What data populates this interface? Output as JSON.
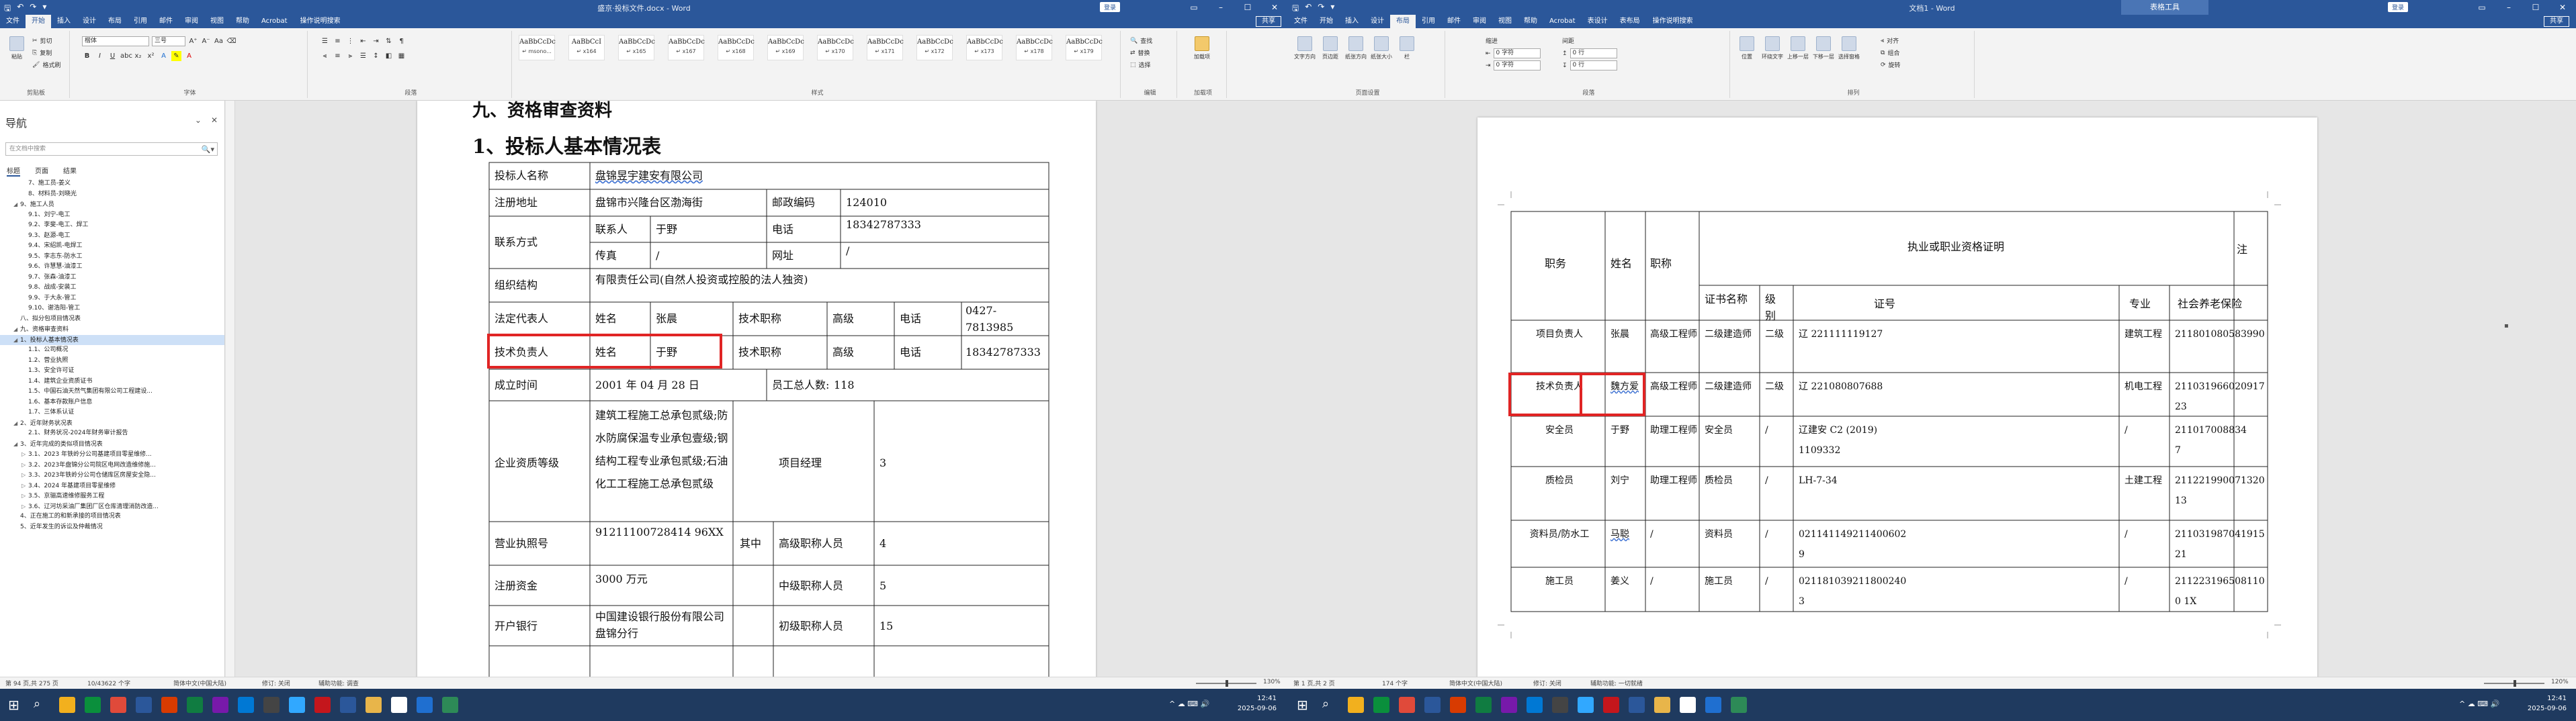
{
  "left": {
    "title": "盛京·投标文件.docx - Word",
    "user_button": "登录",
    "share": "共享",
    "tabs": [
      "文件",
      "开始",
      "插入",
      "设计",
      "布局",
      "引用",
      "邮件",
      "审阅",
      "视图",
      "帮助",
      "Acrobat"
    ],
    "tell_me": "操作说明搜索",
    "ribbon": {
      "clipboard": {
        "label": "剪贴板",
        "paste": "粘贴",
        "cut": "剪切",
        "copy": "复制",
        "painter": "格式刷"
      },
      "font": {
        "label": "字体",
        "name": "楷体",
        "size": "三号"
      },
      "paragraph": {
        "label": "段落"
      },
      "styles": {
        "label": "样式",
        "items": [
          {
            "sample": "AaBbCcDc",
            "name": "↵ msono..."
          },
          {
            "sample": "AaBbCcI",
            "name": "↵ x164"
          },
          {
            "sample": "AaBbCcDc",
            "name": "↵ x165"
          },
          {
            "sample": "AaBbCcDc",
            "name": "↵ x167"
          },
          {
            "sample": "AaBbCcDc",
            "name": "↵ x168"
          },
          {
            "sample": "AaBbCcDc",
            "name": "↵ x169"
          },
          {
            "sample": "AaBbCcDc",
            "name": "↵ x170"
          },
          {
            "sample": "AaBbCcDc",
            "name": "↵ x171"
          },
          {
            "sample": "AaBbCcDc",
            "name": "↵ x172"
          },
          {
            "sample": "AaBbCcDc",
            "name": "↵ x173"
          },
          {
            "sample": "AaBbCcDc",
            "name": "↵ x178"
          },
          {
            "sample": "AaBbCcDc",
            "name": "↵ x179"
          }
        ]
      },
      "editing": {
        "label": "编辑",
        "find": "查找",
        "replace": "替换",
        "select": "选择"
      },
      "addin": {
        "label": "加载项",
        "btn": "加载项"
      }
    },
    "nav": {
      "title": "导航",
      "search_placeholder": "在文档中搜索",
      "tabs": [
        "标题",
        "页面",
        "结果"
      ],
      "items": [
        {
          "level": 2,
          "caret": "",
          "text": "7、施工员-姜义"
        },
        {
          "level": 2,
          "caret": "",
          "text": "8、材料员-刘晓光"
        },
        {
          "level": 1,
          "caret": "◢",
          "text": "9、施工人员"
        },
        {
          "level": 2,
          "caret": "",
          "text": "9.1、刘宁-电工"
        },
        {
          "level": 2,
          "caret": "",
          "text": "9.2、李斐-电工、焊工"
        },
        {
          "level": 2,
          "caret": "",
          "text": "9.3、赵源-电工"
        },
        {
          "level": 2,
          "caret": "",
          "text": "9.4、宋绍凯-电焊工"
        },
        {
          "level": 2,
          "caret": "",
          "text": "9.5、李志东-防水工"
        },
        {
          "level": 2,
          "caret": "",
          "text": "9.6、许慧慧-油漆工"
        },
        {
          "level": 2,
          "caret": "",
          "text": "9.7、张森-油漆工"
        },
        {
          "level": 2,
          "caret": "",
          "text": "9.8、战成-安装工"
        },
        {
          "level": 2,
          "caret": "",
          "text": "9.9、于大永-管工"
        },
        {
          "level": 2,
          "caret": "",
          "text": "9.10、谢浩阳-管工"
        },
        {
          "level": 1,
          "caret": "",
          "text": "八、拟分包项目情况表"
        },
        {
          "level": 1,
          "caret": "◢",
          "text": "九、资格审查资料"
        },
        {
          "level": 1,
          "caret": "◢",
          "text": "1、投标人基本情况表",
          "selected": true
        },
        {
          "level": 2,
          "caret": "",
          "text": "1.1、公司概况"
        },
        {
          "level": 2,
          "caret": "",
          "text": "1.2、营业执照"
        },
        {
          "level": 2,
          "caret": "",
          "text": "1.3、安全许可证"
        },
        {
          "level": 2,
          "caret": "",
          "text": "1.4、建筑企业资质证书"
        },
        {
          "level": 2,
          "caret": "",
          "text": "1.5、中国石油天然气集团有限公司工程建设..."
        },
        {
          "level": 2,
          "caret": "",
          "text": "1.6、基本存款账户信息"
        },
        {
          "level": 2,
          "caret": "",
          "text": "1.7、三体系认证"
        },
        {
          "level": 1,
          "caret": "◢",
          "text": "2、近年财务状况表"
        },
        {
          "level": 2,
          "caret": "",
          "text": "2.1、财务状况-2024年财务审计报告"
        },
        {
          "level": 1,
          "caret": "◢",
          "text": "3、近年完成的类似项目情况表"
        },
        {
          "level": 2,
          "caret": "▷",
          "text": "3.1、2023 年铁岭分公司基建项目零星维修..."
        },
        {
          "level": 2,
          "caret": "▷",
          "text": "3.2、2023年盘锦分公司院区电网改造维修施..."
        },
        {
          "level": 2,
          "caret": "▷",
          "text": "3.3、2023年铁岭分公司仓储库区房屋安全隐..."
        },
        {
          "level": 2,
          "caret": "▷",
          "text": "3.4、2024 年基建项目零星维修"
        },
        {
          "level": 2,
          "caret": "▷",
          "text": "3.5、京骊高速维修服务工程"
        },
        {
          "level": 2,
          "caret": "▷",
          "text": "3.6、辽河坊采油厂集团厂区仓库清理消防改造..."
        },
        {
          "level": 1,
          "caret": "",
          "text": "4、正在施工的和新承接的项目情况表"
        },
        {
          "level": 1,
          "caret": "",
          "text": "5、近年发生的诉讼及仲裁情况"
        }
      ]
    },
    "doc": {
      "heading": "九、资格审查资料",
      "subheading": "1、投标人基本情况表",
      "rows": {
        "bidder_label": "投标人名称",
        "bidder_value": "盘锦昱宇建安有限公司",
        "addr_label": "注册地址",
        "addr_value": "盘锦市兴隆台区渤海街",
        "post_label": "邮政编码",
        "post_value": "124010",
        "contact_label": "联系方式",
        "person_label": "联系人",
        "person_value": "于野",
        "phone_label": "电话",
        "phone_value": "18342787333",
        "fax_label": "传真",
        "fax_value": "/",
        "web_label": "网址",
        "web_value": "/",
        "org_label": "组织结构",
        "org_value": "有限责任公司(自然人投资或控股的法人独资)",
        "legal_label": "法定代表人",
        "name_label": "姓名",
        "legal_name": "张晨",
        "title_label": "技术职称",
        "legal_title": "高级",
        "tel_label": "电话",
        "legal_tel": "0427-7813985",
        "tech_label": "技术负责人",
        "tech_name": "于野",
        "tech_title": "高级",
        "tech_tel": "18342787333",
        "found_label": "成立时间",
        "found_value": "2001 年 04 月 28 日",
        "staff_label": "员工总人数:",
        "staff_value": "118",
        "qual_label": "企业资质等级",
        "qual_value": "建筑工程施工总承包贰级;防水防腐保温专业承包壹级;钢结构工程专业承包贰级;石油化工工程施工总承包贰级",
        "pm_label": "项目经理",
        "pm_value": "3",
        "license_label": "营业执照号",
        "license_value": "91211100728414 96XX",
        "among_label": "其中",
        "senior_label": "高级职称人员",
        "senior_value": "4",
        "capital_label": "注册资金",
        "capital_value": "3000 万元",
        "mid_label": "中级职称人员",
        "mid_value": "5",
        "bank_label": "开户银行",
        "bank_value": "中国建设银行股份有限公司盘锦分行",
        "junior_label": "初级职称人员",
        "junior_value": "15"
      }
    },
    "status": {
      "page": "第 94 页,共 275 页",
      "words": "10/43622 个字",
      "lang": "简体中文(中国大陆)",
      "track": "修订: 关闭",
      "access": "辅助功能: 调查",
      "zoom": "130%"
    }
  },
  "right": {
    "title": "文档1 - Word",
    "context_tab": "表格工具",
    "user_button": "登录",
    "share": "共享",
    "tabs": [
      "文件",
      "开始",
      "插入",
      "设计",
      "布局",
      "引用",
      "邮件",
      "审阅",
      "视图",
      "帮助",
      "Acrobat",
      "表设计",
      "表布局"
    ],
    "tell_me": "操作说明搜索",
    "ribbon": {
      "page_setup": "页面设置",
      "paragraph": "段落",
      "arrange": "排列",
      "text_dir": "文字方向",
      "margins": "页边距",
      "orientation": "纸张方向",
      "size": "纸张大小",
      "columns": "栏",
      "indent_label": "缩进",
      "spacing_label": "间距",
      "indent_left": "0 字符",
      "indent_right": "0 字符",
      "space_before": "0 行",
      "space_after": "0 行",
      "position": "位置",
      "wrap": "环绕文字",
      "forward": "上移一层",
      "backward": "下移一层",
      "select_pane": "选择窗格",
      "align": "对齐",
      "group": "组合",
      "rotate": "旋转"
    },
    "table": {
      "headers": {
        "role": "职务",
        "name": "姓名",
        "title": "职称",
        "cert_group": "执业或职业资格证明",
        "cert_name": "证书名称",
        "grade": "级别",
        "cert_no": "证号",
        "major": "专业",
        "social": "社会养老保险",
        "note": "注"
      },
      "rows": [
        {
          "role": "项目负责人",
          "name": "张晨",
          "title": "高级工程师",
          "cert": "二级建造师",
          "grade": "二级",
          "no": "辽 221111119127",
          "major": "建筑工程",
          "social": "211801080583990"
        },
        {
          "role": "技术负责人",
          "name": "魏方爱",
          "title": "高级工程师",
          "cert": "二级建造师",
          "grade": "二级",
          "no": "辽 221080807688",
          "major": "机电工程",
          "social": "211031966020917 23"
        },
        {
          "role": "安全员",
          "name": "于野",
          "title": "助理工程师",
          "cert": "安全员",
          "grade": "/",
          "no": "辽建安 C2 (2019) 1109332",
          "major": "/",
          "social": "211017008834 7"
        },
        {
          "role": "质检员",
          "name": "刘宁",
          "title": "助理工程师",
          "cert": "质检员",
          "grade": "/",
          "no": "LH-7-34",
          "major": "土建工程",
          "social": "211221990071320 13"
        },
        {
          "role": "资料员/防水工",
          "name": "马聪",
          "title": "/",
          "cert": "资料员",
          "grade": "/",
          "no": "021141149211400602 9",
          "major": "/",
          "social": "211031987041915 21"
        },
        {
          "role": "施工员",
          "name": "姜义",
          "title": "/",
          "cert": "施工员",
          "grade": "/",
          "no": "021181039211800240 3",
          "major": "/",
          "social": "211223196508110 0 1X"
        }
      ]
    },
    "status": {
      "page": "第 1 页,共 2 页",
      "words": "174 个字",
      "lang": "简体中文(中国大陆)",
      "track": "修订: 关闭",
      "access": "辅助功能: 一切就绪",
      "zoom": "120%"
    }
  },
  "taskbar": {
    "time_left": "12:41",
    "date_left": "2025-09-06",
    "time_right": "12:41",
    "date_right": "2025-09-06"
  },
  "colors": {
    "word_blue": "#2b579a",
    "highlight": "#e02424",
    "selection": "#cde0f7"
  }
}
